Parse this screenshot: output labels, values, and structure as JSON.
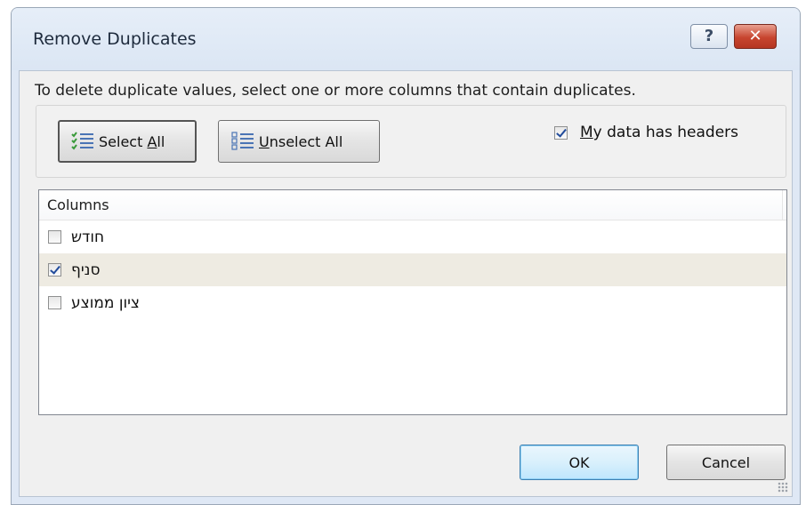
{
  "dialog": {
    "title": "Remove Duplicates",
    "help_label": "?",
    "close_label": "✕",
    "instruction": "To delete duplicate values, select one or more columns that contain duplicates."
  },
  "buttons": {
    "select_all_prefix": "Select ",
    "select_all_access": "A",
    "select_all_suffix": "ll",
    "unselect_all_access": "U",
    "unselect_all_suffix": "nselect All",
    "ok": "OK",
    "cancel": "Cancel"
  },
  "headers_option": {
    "access": "M",
    "rest": "y data has headers",
    "checked": true
  },
  "columns": {
    "header": "Columns",
    "items": [
      {
        "label": "חודש",
        "checked": false,
        "selected": false
      },
      {
        "label": "סניף",
        "checked": true,
        "selected": true
      },
      {
        "label": "ציון ממוצע",
        "checked": false,
        "selected": false
      }
    ]
  },
  "icons": {
    "select_all": "checklist-select-icon",
    "unselect_all": "checklist-unselect-icon"
  }
}
